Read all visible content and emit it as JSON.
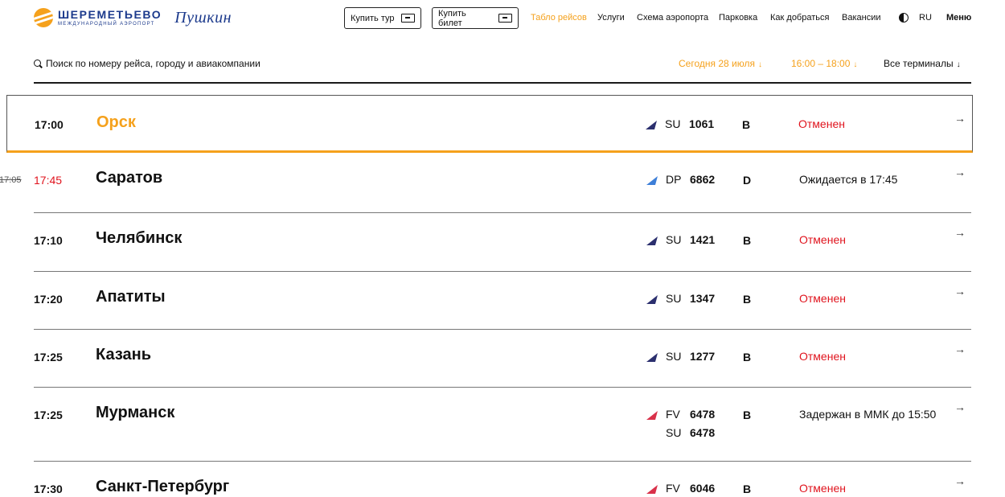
{
  "header": {
    "logo_name": "ШЕРЕМЕТЬЕВО",
    "logo_sub": "МЕЖДУНАРОДНЫЙ АЭРОПОРТ",
    "logo_pushkin": "Пушкин",
    "buy_tour_label": "Купить тур",
    "buy_ticket_label": "Купить билет",
    "nav": [
      {
        "label": "Табло рейсов",
        "active": true
      },
      {
        "label": "Услуги",
        "active": false
      },
      {
        "label": "Схема аэропорта",
        "active": false
      },
      {
        "label": "Парковка",
        "active": false
      },
      {
        "label": "Как добраться",
        "active": false
      },
      {
        "label": "Вакансии",
        "active": false
      }
    ],
    "lang": "RU",
    "menu_label": "Меню"
  },
  "search": {
    "placeholder": "Поиск по номеру рейса, городу и авиакомпании",
    "date_filter": "Сегодня 28 июля",
    "time_filter": "16:00 – 18:00",
    "terminal_filter": "Все терминалы",
    "arrow_glyph": "↓"
  },
  "row_arrow_glyph": "→",
  "flights": [
    {
      "time": "17:00",
      "old_time": "",
      "city": "Орск",
      "airline": "aeroflot",
      "codes": [
        {
          "code": "SU",
          "number": "1061"
        }
      ],
      "terminal": "B",
      "status": "Отменен",
      "cancelled": true
    },
    {
      "time": "17:45",
      "old_time": "17:05",
      "city": "Саратов",
      "airline": "rossiya",
      "codes": [
        {
          "code": "DP",
          "number": "6862"
        }
      ],
      "terminal": "D",
      "status": "Ожидается в 17:45",
      "cancelled": false
    },
    {
      "time": "17:10",
      "old_time": "",
      "city": "Челябинск",
      "airline": "aeroflot",
      "codes": [
        {
          "code": "SU",
          "number": "1421"
        }
      ],
      "terminal": "B",
      "status": "Отменен",
      "cancelled": true
    },
    {
      "time": "17:20",
      "old_time": "",
      "city": "Апатиты",
      "airline": "aeroflot",
      "codes": [
        {
          "code": "SU",
          "number": "1347"
        }
      ],
      "terminal": "B",
      "status": "Отменен",
      "cancelled": true
    },
    {
      "time": "17:25",
      "old_time": "",
      "city": "Казань",
      "airline": "aeroflot",
      "codes": [
        {
          "code": "SU",
          "number": "1277"
        }
      ],
      "terminal": "B",
      "status": "Отменен",
      "cancelled": true
    },
    {
      "time": "17:25",
      "old_time": "",
      "city": "Мурманск",
      "airline": "rossiya-red",
      "codes": [
        {
          "code": "FV",
          "number": "6478"
        },
        {
          "code": "SU",
          "number": "6478"
        }
      ],
      "terminal": "B",
      "status": "Задержан в ММК до 15:50",
      "cancelled": false
    },
    {
      "time": "17:30",
      "old_time": "",
      "city": "Санкт-Петербург",
      "airline": "rossiya-red",
      "codes": [
        {
          "code": "FV",
          "number": "6046"
        }
      ],
      "terminal": "B",
      "status": "Отменен",
      "cancelled": true
    }
  ],
  "colors": {
    "accent": "#f5a11c",
    "cancelled": "#e0141e",
    "aeroflot": "#2b2f6e",
    "rossiya": "#3d7fd8",
    "rossiya_red": "#d9314a"
  }
}
